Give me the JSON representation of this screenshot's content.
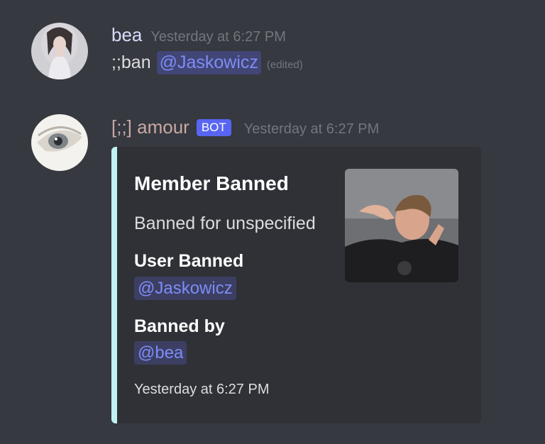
{
  "messages": [
    {
      "username": "bea",
      "username_color": "#d7dcff",
      "timestamp": "Yesterday at 6:27 PM",
      "command": ";;ban",
      "mention": "@Jaskowicz",
      "edited": "(edited)",
      "avatar_icon": "user-avatar"
    },
    {
      "username": "[;;] amour",
      "username_color": "#c9a9a6",
      "badge": "BOT",
      "timestamp": "Yesterday at 6:27 PM",
      "avatar_icon": "bot-avatar"
    }
  ],
  "embed": {
    "accent_color": "#c0f2f2",
    "title": "Member Banned",
    "description": "Banned for unspecified",
    "fields": [
      {
        "name": "User Banned",
        "value": "@Jaskowicz"
      },
      {
        "name": "Banned by",
        "value": "@bea"
      }
    ],
    "footer": "Yesterday at 6:27 PM",
    "thumbnail_icon": "user-photo"
  }
}
